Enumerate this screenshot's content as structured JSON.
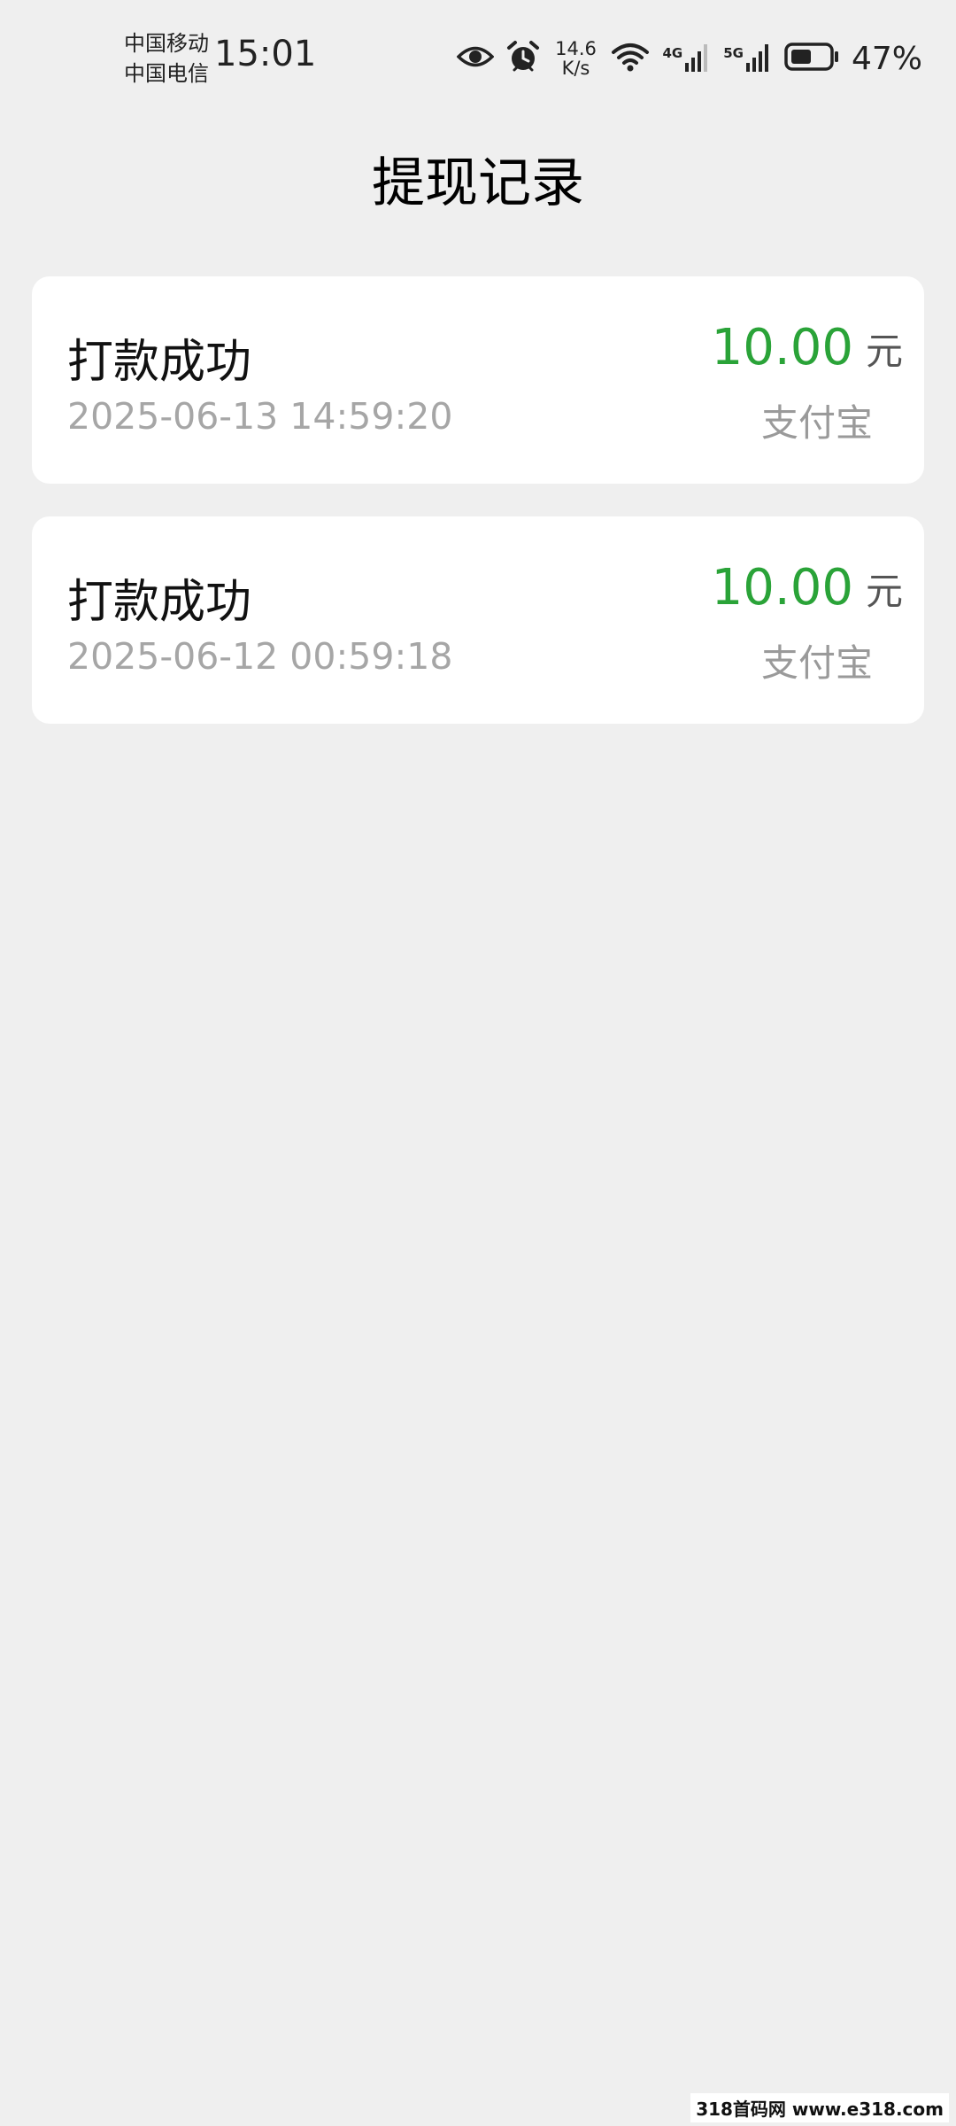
{
  "status_bar": {
    "carrier_1": "中国移动",
    "carrier_2": "中国电信",
    "time": "15:01",
    "net_speed_value": "14.6",
    "net_speed_unit": "K/s",
    "sim1_network": "4G",
    "sim2_network": "5G",
    "battery_percent": "47%",
    "icons": [
      "eye-icon",
      "alarm-icon",
      "wifi-icon",
      "signal-icon",
      "battery-icon"
    ]
  },
  "header": {
    "title": "提现记录"
  },
  "records": [
    {
      "status": "打款成功",
      "time": "2025-06-13 14:59:20",
      "amount": "10.00",
      "unit": "元",
      "channel": "支付宝"
    },
    {
      "status": "打款成功",
      "time": "2025-06-12 00:59:18",
      "amount": "10.00",
      "unit": "元",
      "channel": "支付宝"
    }
  ],
  "watermark": "318首码网 www.e318.com",
  "colors": {
    "background": "#efefef",
    "card": "#ffffff",
    "amount": "#2aa338",
    "secondary_text": "#a6a6a6"
  }
}
